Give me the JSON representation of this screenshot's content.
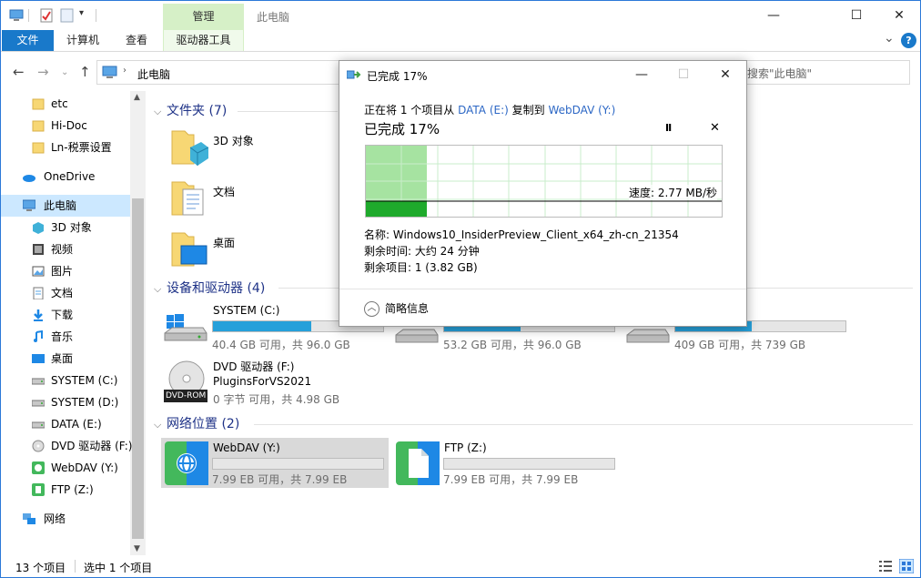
{
  "window": {
    "title": "此电脑",
    "context_tab_header": "管理",
    "controls": {
      "minimize": "—",
      "maximize": "☐",
      "close": "✕"
    }
  },
  "ribbon": {
    "tabs": [
      {
        "label": "文件"
      },
      {
        "label": "计算机"
      },
      {
        "label": "查看"
      },
      {
        "label": "驱动器工具"
      }
    ],
    "collapse_glyph": "⌄",
    "help_glyph": "?"
  },
  "address": {
    "path": "此电脑",
    "search_placeholder": "搜索\"此电脑\""
  },
  "sidebar": {
    "items": [
      {
        "label": "etc",
        "icon": "folder-icon"
      },
      {
        "label": "Hi-Doc",
        "icon": "folder-icon"
      },
      {
        "label": "Ln-税票设置",
        "icon": "folder-icon"
      },
      {
        "label": "OneDrive",
        "icon": "cloud-icon"
      },
      {
        "label": "此电脑",
        "icon": "computer-icon",
        "selected": true
      },
      {
        "label": "3D 对象",
        "icon": "cube-icon"
      },
      {
        "label": "视频",
        "icon": "video-icon"
      },
      {
        "label": "图片",
        "icon": "picture-icon"
      },
      {
        "label": "文档",
        "icon": "document-icon"
      },
      {
        "label": "下载",
        "icon": "download-icon"
      },
      {
        "label": "音乐",
        "icon": "music-icon"
      },
      {
        "label": "桌面",
        "icon": "desktop-icon"
      },
      {
        "label": "SYSTEM (C:)",
        "icon": "drive-icon"
      },
      {
        "label": "SYSTEM (D:)",
        "icon": "drive-icon"
      },
      {
        "label": "DATA (E:)",
        "icon": "drive-icon"
      },
      {
        "label": "DVD 驱动器 (F:)",
        "icon": "dvd-icon"
      },
      {
        "label": "WebDAV (Y:)",
        "icon": "webdav-icon"
      },
      {
        "label": "FTP (Z:)",
        "icon": "ftp-icon"
      },
      {
        "label": "网络",
        "icon": "network-icon"
      }
    ]
  },
  "main": {
    "folders_group": "文件夹 (7)",
    "folders": [
      {
        "label": "3D 对象"
      },
      {
        "label": "文档"
      },
      {
        "label": "桌面"
      }
    ],
    "devices_group": "设备和驱动器 (4)",
    "drives": [
      {
        "name": "SYSTEM (C:)",
        "info": "40.4 GB 可用，共 96.0 GB",
        "used_fraction": 0.58
      },
      {
        "name": "",
        "info": "53.2 GB 可用，共 96.0 GB",
        "used_fraction": 0.45
      },
      {
        "name": "",
        "info": "409 GB 可用，共 739 GB",
        "used_fraction": 0.45
      }
    ],
    "dvd": {
      "name": "DVD 驱动器 (F:)",
      "volume": "PluginsForVS2021",
      "info": "0 字节 可用，共 4.98 GB",
      "badge": "DVD-ROM"
    },
    "network_group": "网络位置 (2)",
    "network": [
      {
        "name": "WebDAV (Y:)",
        "info": "7.99 EB 可用，共 7.99 EB",
        "used_fraction": 0
      },
      {
        "name": "FTP (Z:)",
        "info": "7.99 EB 可用，共 7.99 EB",
        "used_fraction": 0
      }
    ]
  },
  "status": {
    "count": "13 个项目",
    "selection": "选中 1 个项目"
  },
  "dialog": {
    "title": "已完成 17%",
    "copy_prefix": "正在将 1 个项目从 ",
    "source": "DATA (E:)",
    "copy_middle": " 复制到 ",
    "dest": "WebDAV (Y:)",
    "percent_text": "已完成 17%",
    "progress_fraction": 0.17,
    "speed": "速度: 2.77 MB/秒",
    "name_line": "名称: Windows10_InsiderPreview_Client_x64_zh-cn_21354",
    "time_line": "剩余时间: 大约 24 分钟",
    "items_line": "剩余项目: 1 (3.82 GB)",
    "less_info": "简略信息",
    "pause_glyph": "II",
    "cancel_glyph": "✕",
    "colors": {
      "graph_fill": "#a6e3a1",
      "graph_bar": "#1faa2c",
      "grid": "#c9eccb"
    }
  }
}
